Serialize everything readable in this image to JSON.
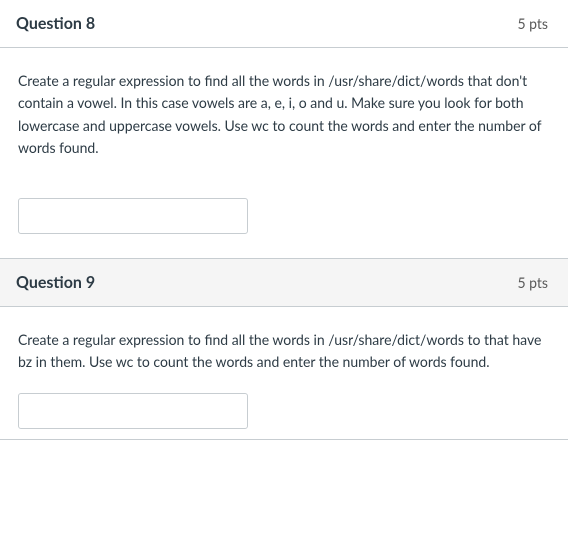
{
  "questions": [
    {
      "title": "Question 8",
      "points": "5 pts",
      "prompt": "Create a regular expression to find all the words in /usr/share/dict/words that don't contain a vowel. In this case vowels are a, e, i, o and u. Make sure you look for both lowercase and uppercase vowels. Use wc to count the words and enter the number of words found.",
      "answer": ""
    },
    {
      "title": "Question 9",
      "points": "5 pts",
      "prompt": "Create a regular expression to find all the words in /usr/share/dict/words to  that have bz in them.  Use wc to count the words and enter the number of words found.",
      "answer": ""
    }
  ]
}
